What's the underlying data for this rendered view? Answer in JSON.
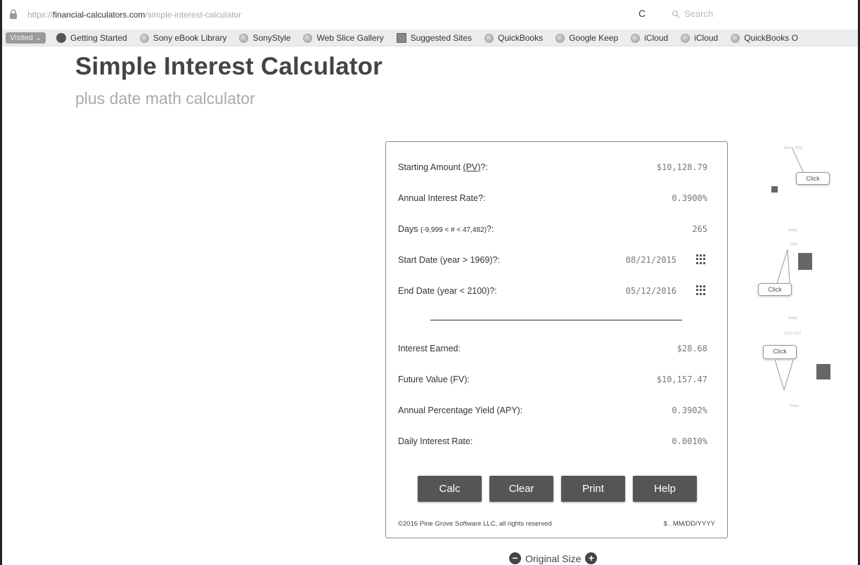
{
  "browser": {
    "url_scheme": "https://",
    "url_host": "financial-calculators.com",
    "url_path": "/simple-interest-calculator",
    "search_placeholder": "Search"
  },
  "bookmarks": {
    "visited_label": "Visited",
    "items": [
      "Getting Started",
      "Sony eBook Library",
      "SonyStyle",
      "Web Slice Gallery",
      "Suggested Sites",
      "QuickBooks",
      "Google Keep",
      "iCloud",
      "iCloud",
      "QuickBooks O"
    ]
  },
  "page": {
    "title": "Simple Interest Calculator",
    "subtitle": "plus date math calculator"
  },
  "calculator": {
    "inputs": [
      {
        "label": "Starting Amount ",
        "label_link": "(PV)",
        "label_suffix": "?:",
        "value": "$10,128.79"
      },
      {
        "label": "Annual Interest Rate?:",
        "value": "0.3900%"
      },
      {
        "label": "Days ",
        "label_small": "(-9,999 < # < 47,482)",
        "label_suffix": "?:",
        "value": "265"
      },
      {
        "label": "Start Date (year > 1969)?:",
        "value": "08/21/2015"
      },
      {
        "label": "End Date (year < 2100)?:",
        "value": "05/12/2016"
      }
    ],
    "results": [
      {
        "label": "Interest Earned:",
        "value": "$28.68"
      },
      {
        "label": "Future Value (FV):",
        "value": "$10,157.47"
      },
      {
        "label": "Annual Percentage Yield (APY):",
        "value": "0.3902%"
      },
      {
        "label": "Daily Interest Rate:",
        "value": "0.0010%"
      }
    ],
    "buttons": {
      "calc": "Calc",
      "clear": "Clear",
      "print": "Print",
      "help": "Help"
    },
    "copyright": "©2016 Pine Grove Software LLC, all rights reserved",
    "format_hint": "$ . MM/DD/YYYY"
  },
  "zoom": {
    "label": "Original Size"
  },
  "side_illustration": {
    "callout_label": "Click",
    "month_header": "March 2016",
    "today_label": "Today",
    "year_label": "2016",
    "decade_label": "2010-2019"
  }
}
